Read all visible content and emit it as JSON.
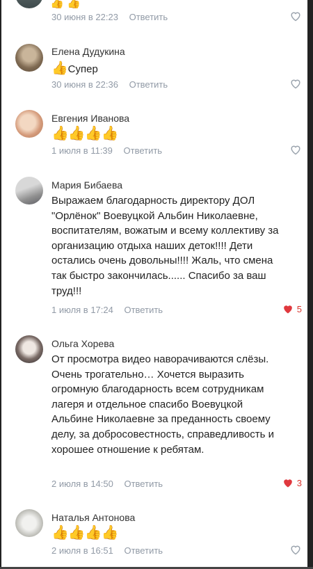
{
  "top_partial": {
    "time": "30 июня в 22:23",
    "reply": "Ответить"
  },
  "comments": [
    {
      "name": "Елена Дудукина",
      "text": "Супер",
      "time": "30 июня в 22:36",
      "reply": "Ответить",
      "likes": ""
    },
    {
      "name": "Евгения Иванова",
      "text": "",
      "time": "1 июля в 11:39",
      "reply": "Ответить",
      "likes": ""
    },
    {
      "name": "Мария Бибаева",
      "text": "Выражаем благодарность директору ДОЛ \"Орлёнок\" Воевуцкой Альбин Николаевне, воспитателям, вожатым и всему коллективу за организацию отдыха наших деток!!!! Дети остались очень довольны!!!! Жаль, что смена так быстро закончилась...... Спасибо за ваш труд!!!",
      "time": "1 июля в 17:24",
      "reply": "Ответить",
      "likes": "5"
    },
    {
      "name": "Ольга Хорева",
      "text": "От просмотра видео наворачиваются слёзы. Очень трогательно… Хочется выразить огромную благодарность всем сотрудникам лагеря и отдельное спасибо Воевуцкой Альбине Николаевне за преданность своему делу, за добросовестность, справедливость и хорошее отношение к ребятам.",
      "time": "2 июля в 14:50",
      "reply": "Ответить",
      "likes": "3"
    },
    {
      "name": "Наталья Антонова",
      "text": "",
      "time": "2 июля в 16:51",
      "reply": "Ответить",
      "likes": ""
    }
  ],
  "colors": {
    "liked_heart": "#e0383e",
    "meta_gray": "#919aa6",
    "thumb_yellow": "#f2b62d"
  }
}
